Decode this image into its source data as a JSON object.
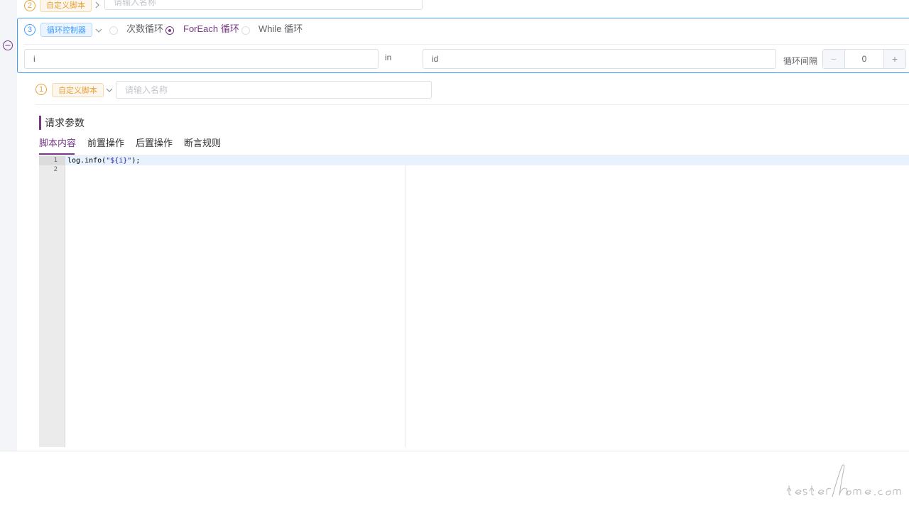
{
  "step2": {
    "number": "2",
    "tag_label": "自定义脚本",
    "name_placeholder": "请输入名称"
  },
  "step3": {
    "number": "3",
    "tag_label": "循环控制器",
    "loop_options": [
      {
        "label": "次数循环",
        "checked": false
      },
      {
        "label": "ForEach 循环",
        "checked": true
      },
      {
        "label": "While 循环",
        "checked": false
      }
    ],
    "variable_value": "i",
    "in_label": "in",
    "collection_value": "id",
    "interval_label": "循环间隔",
    "interval_value": "0",
    "minus_symbol": "−",
    "plus_symbol": "+"
  },
  "step1": {
    "number": "1",
    "tag_label": "自定义脚本",
    "name_placeholder": "请输入名称",
    "section_title": "请求参数",
    "tabs": [
      "脚本内容",
      "前置操作",
      "后置操作",
      "断言规则"
    ],
    "active_tab": "脚本内容"
  },
  "editor": {
    "line_numbers": [
      "1",
      "2"
    ],
    "code_prefix": "log.info(",
    "code_string": "\"${i}\"",
    "code_suffix": ");"
  },
  "colors": {
    "accent": "#783887",
    "primary": "#409eff",
    "warning": "#e6a23c"
  },
  "icons": {
    "collapse": "minus-circle-icon",
    "chevron": "chevron-down-icon",
    "chevron_right": "chevron-right-icon"
  }
}
